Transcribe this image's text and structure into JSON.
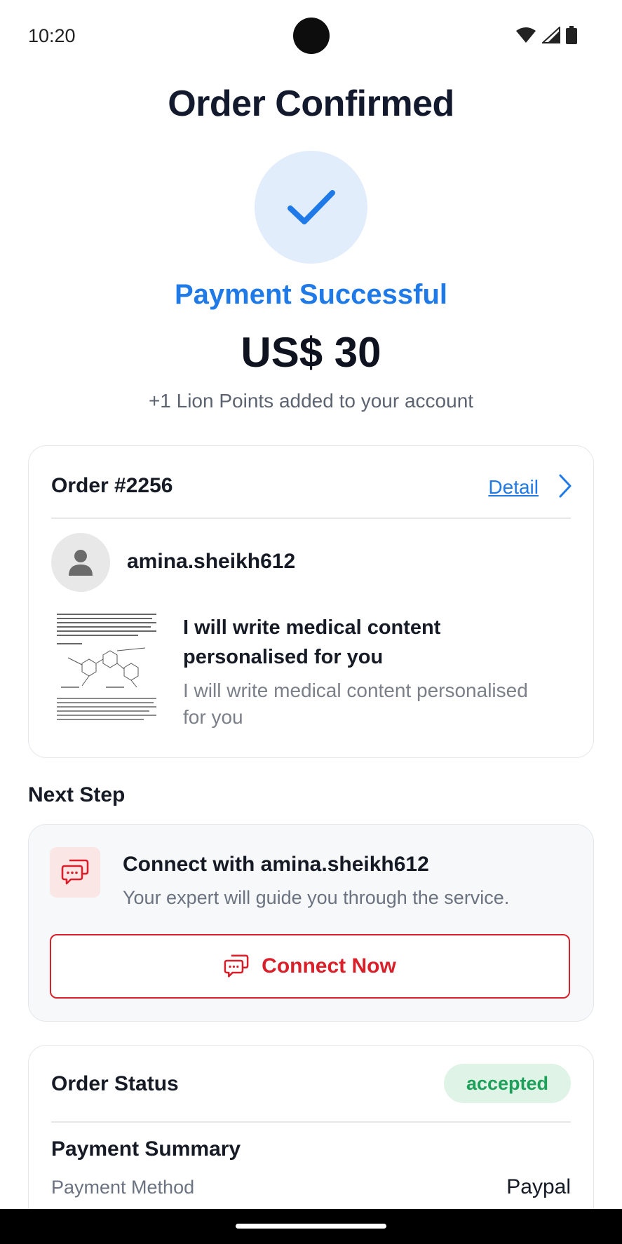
{
  "status_bar": {
    "time": "10:20"
  },
  "page": {
    "title": "Order Confirmed",
    "payment_status": "Payment Successful",
    "amount": "US$ 30",
    "points_note": "+1 Lion Points added to your account"
  },
  "order": {
    "number": "Order #2256",
    "detail_label": "Detail",
    "seller": "amina.sheikh612",
    "gig_title": "I will write medical content personalised for you",
    "gig_subtitle": "I will write medical content personalised for you"
  },
  "next_step": {
    "heading": "Next Step",
    "title": "Connect with amina.sheikh612",
    "subtitle": "Your expert will guide you through the service.",
    "button_label": "Connect Now"
  },
  "order_status": {
    "label": "Order Status",
    "badge": "accepted",
    "payment_summary_heading": "Payment Summary",
    "payment_method_label": "Payment Method",
    "payment_method_value": "Paypal"
  },
  "colors": {
    "accent_blue": "#1f7ae8",
    "accent_red": "#d81f2a",
    "badge_green": "#1ea05a"
  },
  "icons": [
    "wifi-icon",
    "signal-icon",
    "battery-icon",
    "check-icon",
    "chevron-right-icon",
    "person-icon",
    "chat-bubbles-icon"
  ]
}
